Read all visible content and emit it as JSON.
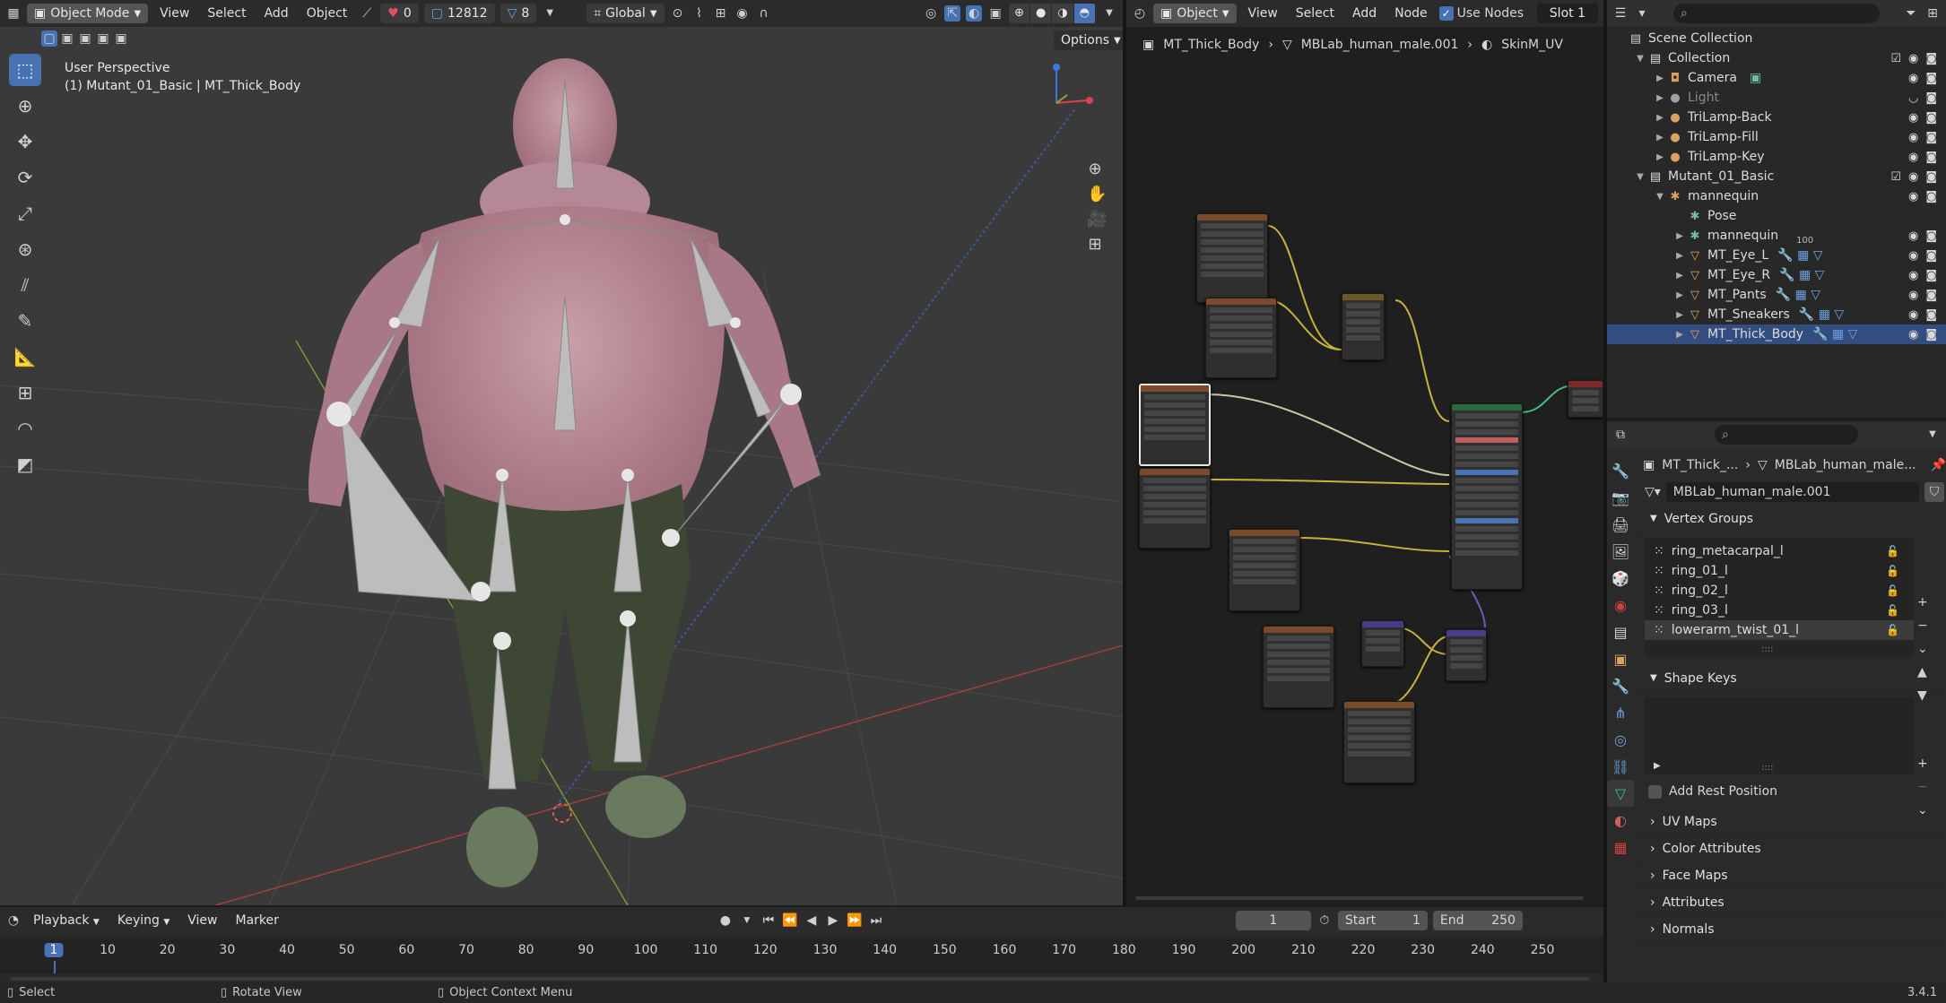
{
  "viewport_header": {
    "mode": "Object Mode",
    "menus": [
      "View",
      "Select",
      "Add",
      "Object"
    ],
    "stat_a": "0",
    "stat_b": "12812",
    "stat_c": "8",
    "transform_orientation": "Global",
    "options_label": "Options"
  },
  "viewport": {
    "view_name": "User Perspective",
    "object_info": "(1) Mutant_01_Basic | MT_Thick_Body"
  },
  "node_editor": {
    "header": {
      "type_label": "Object",
      "menus": [
        "View",
        "Select",
        "Add",
        "Node"
      ],
      "use_nodes_label": "Use Nodes",
      "use_nodes_checked": true,
      "slot_label": "Slot 1"
    },
    "breadcrumb": [
      "MT_Thick_Body",
      "MBLab_human_male.001",
      "SkinM_UV"
    ]
  },
  "outliner": {
    "search_placeholder": "",
    "rows": [
      {
        "label": "Scene Collection",
        "indent": 0,
        "icon": "scene-collection-icon",
        "glyph": "▤",
        "color": "#d0d0d0"
      },
      {
        "label": "Collection",
        "indent": 1,
        "icon": "collection-icon",
        "glyph": "▤",
        "color": "#e0e0e0",
        "checkbox": true
      },
      {
        "label": "Camera",
        "indent": 2,
        "icon": "camera-icon",
        "glyph": "◘",
        "color": "#e0a060",
        "extra": "▣"
      },
      {
        "label": "Light",
        "indent": 2,
        "icon": "light-icon",
        "glyph": "●",
        "color": "#a0a0a0",
        "dim": true
      },
      {
        "label": "TriLamp-Back",
        "indent": 2,
        "icon": "lamp-icon",
        "glyph": "●",
        "color": "#e0a060"
      },
      {
        "label": "TriLamp-Fill",
        "indent": 2,
        "icon": "lamp-icon",
        "glyph": "●",
        "color": "#e0a060"
      },
      {
        "label": "TriLamp-Key",
        "indent": 2,
        "icon": "lamp-icon",
        "glyph": "●",
        "color": "#e0a060"
      },
      {
        "label": "Mutant_01_Basic",
        "indent": 1,
        "icon": "collection-icon",
        "glyph": "▤",
        "color": "#e0e0e0",
        "checkbox": true
      },
      {
        "label": "mannequin",
        "indent": 2,
        "icon": "armature-icon",
        "glyph": "✱",
        "color": "#e0a060"
      },
      {
        "label": "Pose",
        "indent": 3,
        "icon": "pose-icon",
        "glyph": "✱",
        "color": "#70c0a0"
      },
      {
        "label": "mannequin",
        "indent": 3,
        "icon": "armature-data-icon",
        "glyph": "✱",
        "color": "#70c0a0",
        "badge": "100"
      },
      {
        "label": "MT_Eye_L",
        "indent": 3,
        "icon": "mesh-icon",
        "glyph": "▽",
        "color": "#e0a060"
      },
      {
        "label": "MT_Eye_R",
        "indent": 3,
        "icon": "mesh-icon",
        "glyph": "▽",
        "color": "#e0a060"
      },
      {
        "label": "MT_Pants",
        "indent": 3,
        "icon": "mesh-icon",
        "glyph": "▽",
        "color": "#e0a060"
      },
      {
        "label": "MT_Sneakers",
        "indent": 3,
        "icon": "mesh-icon",
        "glyph": "▽",
        "color": "#e0a060"
      },
      {
        "label": "MT_Thick_Body",
        "indent": 3,
        "icon": "mesh-icon",
        "glyph": "▽",
        "color": "#e0a060",
        "active": true
      }
    ]
  },
  "properties": {
    "breadcrumb_object": "MT_Thick_...",
    "breadcrumb_data": "MBLab_human_male...",
    "mesh_name": "MBLab_human_male.001",
    "vertex_groups_title": "Vertex Groups",
    "vertex_groups": [
      "ring_metacarpal_l",
      "ring_01_l",
      "ring_02_l",
      "ring_03_l",
      "lowerarm_twist_01_l"
    ],
    "shape_keys_title": "Shape Keys",
    "add_rest_position": "Add Rest Position",
    "sections": [
      "UV Maps",
      "Color Attributes",
      "Face Maps",
      "Attributes",
      "Normals"
    ]
  },
  "timeline": {
    "menus": [
      "Playback",
      "Keying",
      "View",
      "Marker"
    ],
    "current_frame": "1",
    "start_label": "Start",
    "start_value": "1",
    "end_label": "End",
    "end_value": "250",
    "ticks": [
      "1",
      "10",
      "20",
      "30",
      "40",
      "50",
      "60",
      "70",
      "80",
      "90",
      "100",
      "110",
      "120",
      "130",
      "140",
      "150",
      "160",
      "170",
      "180",
      "190",
      "200",
      "210",
      "220",
      "230",
      "240",
      "250"
    ]
  },
  "statusbar": {
    "left": "Select",
    "middle": "Rotate View",
    "right": "Object Context Menu",
    "version": "3.4.1"
  },
  "colors": {
    "accent": "#4772b3",
    "header_bg": "#303030",
    "viewport_bg": "#3a3a3a"
  }
}
